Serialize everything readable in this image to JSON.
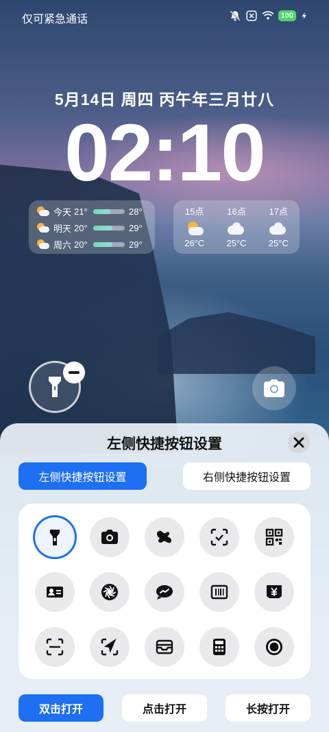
{
  "status_bar": {
    "carrier_text": "仅可紧急通话",
    "battery": "100"
  },
  "lockscreen": {
    "date": "5月14日 周四 丙午年三月廿八",
    "time": "02:10"
  },
  "weather": {
    "daily": [
      {
        "day": "今天",
        "low": "21°",
        "high": "28°",
        "icon": "sun-cloud-icon",
        "bar_start": 0.0,
        "bar_end": 0.55
      },
      {
        "day": "明天",
        "low": "20°",
        "high": "29°",
        "icon": "sun-cloud-icon",
        "bar_start": 0.0,
        "bar_end": 0.6
      },
      {
        "day": "周六",
        "low": "20°",
        "high": "29°",
        "icon": "sun-cloud-icon",
        "bar_start": 0.0,
        "bar_end": 0.6
      }
    ],
    "hourly": [
      {
        "hour": "15点",
        "temp": "26°C",
        "icon": "sun-cloud-icon"
      },
      {
        "hour": "16点",
        "temp": "25°C",
        "icon": "cloud-icon"
      },
      {
        "hour": "17点",
        "temp": "25°C",
        "icon": "cloud-icon"
      }
    ]
  },
  "sheet": {
    "title": "左侧快捷按钮设置",
    "tabs": {
      "left": "左侧快捷按钮设置",
      "right": "右侧快捷按钮设置"
    },
    "icons": [
      "flashlight-icon",
      "camera-icon",
      "cloud-shape-icon",
      "scan-check-icon",
      "qr-code-icon",
      "id-card-icon",
      "aperture-icon",
      "chat-bubble-icon",
      "barcode-icon",
      "payment-icon",
      "scan-icon",
      "navigation-icon",
      "wallet-icon",
      "calculator-icon",
      "record-icon"
    ],
    "actions": {
      "double": "双击打开",
      "click": "点击打开",
      "long": "长按打开"
    }
  },
  "colors": {
    "accent": "#1e6ff2",
    "battery": "#4cd964"
  }
}
